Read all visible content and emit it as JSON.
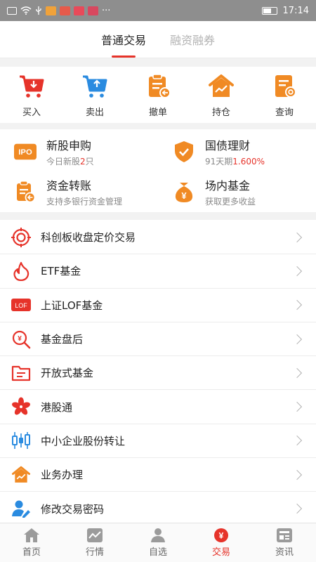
{
  "status_bar": {
    "time": "17:14",
    "more": "···"
  },
  "tabs": [
    {
      "label": "普通交易",
      "active": true
    },
    {
      "label": "融资融券",
      "active": false
    }
  ],
  "quick_actions": [
    {
      "label": "买入",
      "icon": "cart-down-icon"
    },
    {
      "label": "卖出",
      "icon": "cart-up-icon"
    },
    {
      "label": "撤单",
      "icon": "clipboard-cancel-icon"
    },
    {
      "label": "持仓",
      "icon": "house-chart-icon"
    },
    {
      "label": "查询",
      "icon": "document-search-icon"
    }
  ],
  "features": [
    {
      "title": "新股申购",
      "sub_prefix": "今日新股",
      "sub_highlight": "2",
      "sub_suffix": "只",
      "icon": "ipo-icon"
    },
    {
      "title": "国债理财",
      "sub_prefix": "91天期",
      "sub_highlight": "1.600%",
      "sub_suffix": "",
      "icon": "shield-check-icon"
    },
    {
      "title": "资金转账",
      "sub_prefix": "支持多银行资金管理",
      "sub_highlight": "",
      "sub_suffix": "",
      "icon": "clipboard-transfer-icon"
    },
    {
      "title": "场内基金",
      "sub_prefix": "获取更多收益",
      "sub_highlight": "",
      "sub_suffix": "",
      "icon": "money-bag-icon"
    }
  ],
  "ipo_icon_text": "IPO",
  "lof_icon_text": "LOF",
  "list_items": [
    {
      "label": "科创板收盘定价交易",
      "icon": "target-icon"
    },
    {
      "label": "ETF基金",
      "icon": "flame-icon"
    },
    {
      "label": "上证LOF基金",
      "icon": "lof-badge-icon"
    },
    {
      "label": "基金盘后",
      "icon": "magnifier-yen-icon"
    },
    {
      "label": "开放式基金",
      "icon": "folder-icon"
    },
    {
      "label": "港股通",
      "icon": "bauhinia-icon"
    },
    {
      "label": "中小企业股份转让",
      "icon": "candlestick-icon"
    },
    {
      "label": "业务办理",
      "icon": "house-chart-icon"
    },
    {
      "label": "修改交易密码",
      "icon": "user-edit-icon"
    }
  ],
  "bottom_nav": [
    {
      "label": "首页",
      "icon": "home-icon",
      "active": false
    },
    {
      "label": "行情",
      "icon": "chart-icon",
      "active": false
    },
    {
      "label": "自选",
      "icon": "user-icon",
      "active": false
    },
    {
      "label": "交易",
      "icon": "trade-yen-icon",
      "active": true
    },
    {
      "label": "资讯",
      "icon": "news-icon",
      "active": false
    }
  ],
  "colors": {
    "accent": "#e6332a",
    "orange": "#f08a24",
    "blue": "#2a8be0"
  }
}
